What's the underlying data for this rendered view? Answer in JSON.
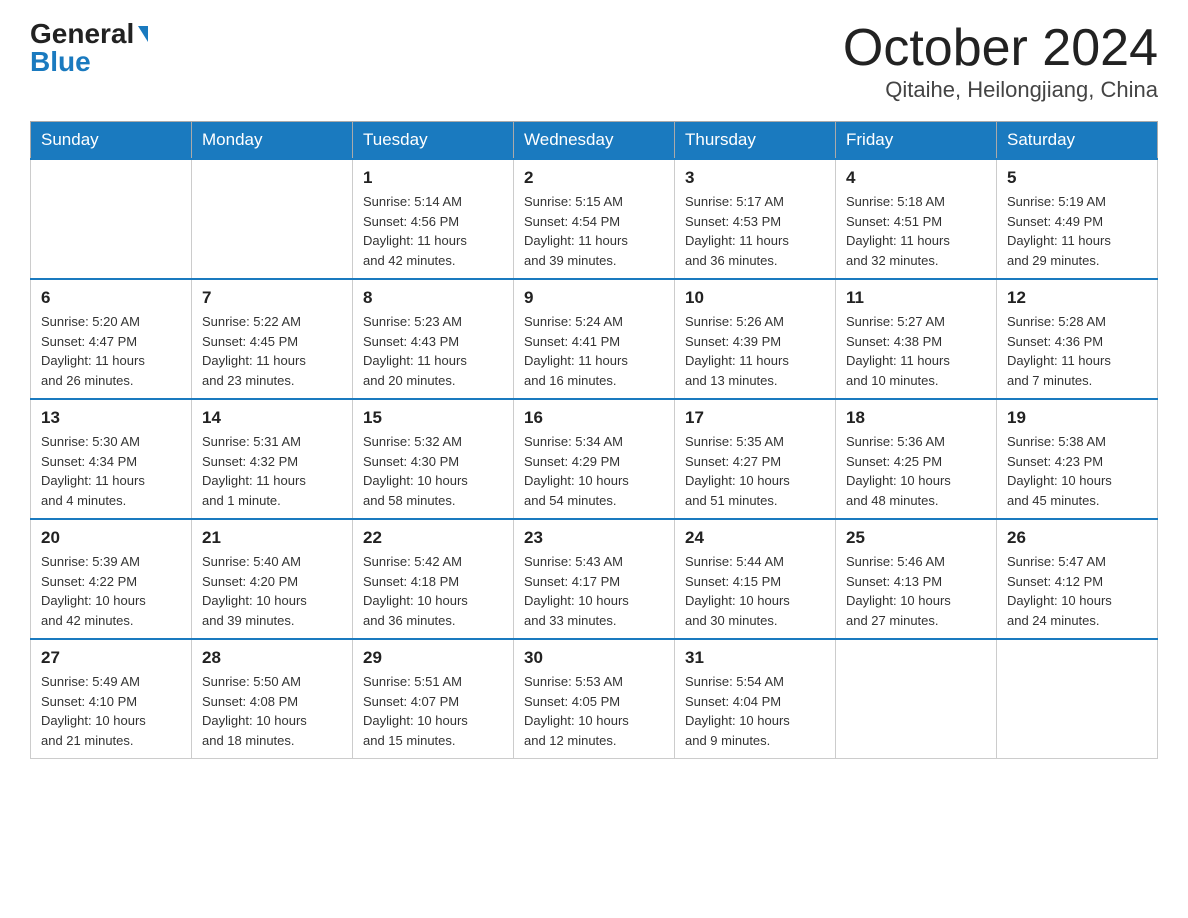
{
  "header": {
    "logo_general": "General",
    "logo_blue": "Blue",
    "month": "October 2024",
    "location": "Qitaihe, Heilongjiang, China"
  },
  "days_of_week": [
    "Sunday",
    "Monday",
    "Tuesday",
    "Wednesday",
    "Thursday",
    "Friday",
    "Saturday"
  ],
  "weeks": [
    [
      {
        "day": "",
        "info": ""
      },
      {
        "day": "",
        "info": ""
      },
      {
        "day": "1",
        "info": "Sunrise: 5:14 AM\nSunset: 4:56 PM\nDaylight: 11 hours\nand 42 minutes."
      },
      {
        "day": "2",
        "info": "Sunrise: 5:15 AM\nSunset: 4:54 PM\nDaylight: 11 hours\nand 39 minutes."
      },
      {
        "day": "3",
        "info": "Sunrise: 5:17 AM\nSunset: 4:53 PM\nDaylight: 11 hours\nand 36 minutes."
      },
      {
        "day": "4",
        "info": "Sunrise: 5:18 AM\nSunset: 4:51 PM\nDaylight: 11 hours\nand 32 minutes."
      },
      {
        "day": "5",
        "info": "Sunrise: 5:19 AM\nSunset: 4:49 PM\nDaylight: 11 hours\nand 29 minutes."
      }
    ],
    [
      {
        "day": "6",
        "info": "Sunrise: 5:20 AM\nSunset: 4:47 PM\nDaylight: 11 hours\nand 26 minutes."
      },
      {
        "day": "7",
        "info": "Sunrise: 5:22 AM\nSunset: 4:45 PM\nDaylight: 11 hours\nand 23 minutes."
      },
      {
        "day": "8",
        "info": "Sunrise: 5:23 AM\nSunset: 4:43 PM\nDaylight: 11 hours\nand 20 minutes."
      },
      {
        "day": "9",
        "info": "Sunrise: 5:24 AM\nSunset: 4:41 PM\nDaylight: 11 hours\nand 16 minutes."
      },
      {
        "day": "10",
        "info": "Sunrise: 5:26 AM\nSunset: 4:39 PM\nDaylight: 11 hours\nand 13 minutes."
      },
      {
        "day": "11",
        "info": "Sunrise: 5:27 AM\nSunset: 4:38 PM\nDaylight: 11 hours\nand 10 minutes."
      },
      {
        "day": "12",
        "info": "Sunrise: 5:28 AM\nSunset: 4:36 PM\nDaylight: 11 hours\nand 7 minutes."
      }
    ],
    [
      {
        "day": "13",
        "info": "Sunrise: 5:30 AM\nSunset: 4:34 PM\nDaylight: 11 hours\nand 4 minutes."
      },
      {
        "day": "14",
        "info": "Sunrise: 5:31 AM\nSunset: 4:32 PM\nDaylight: 11 hours\nand 1 minute."
      },
      {
        "day": "15",
        "info": "Sunrise: 5:32 AM\nSunset: 4:30 PM\nDaylight: 10 hours\nand 58 minutes."
      },
      {
        "day": "16",
        "info": "Sunrise: 5:34 AM\nSunset: 4:29 PM\nDaylight: 10 hours\nand 54 minutes."
      },
      {
        "day": "17",
        "info": "Sunrise: 5:35 AM\nSunset: 4:27 PM\nDaylight: 10 hours\nand 51 minutes."
      },
      {
        "day": "18",
        "info": "Sunrise: 5:36 AM\nSunset: 4:25 PM\nDaylight: 10 hours\nand 48 minutes."
      },
      {
        "day": "19",
        "info": "Sunrise: 5:38 AM\nSunset: 4:23 PM\nDaylight: 10 hours\nand 45 minutes."
      }
    ],
    [
      {
        "day": "20",
        "info": "Sunrise: 5:39 AM\nSunset: 4:22 PM\nDaylight: 10 hours\nand 42 minutes."
      },
      {
        "day": "21",
        "info": "Sunrise: 5:40 AM\nSunset: 4:20 PM\nDaylight: 10 hours\nand 39 minutes."
      },
      {
        "day": "22",
        "info": "Sunrise: 5:42 AM\nSunset: 4:18 PM\nDaylight: 10 hours\nand 36 minutes."
      },
      {
        "day": "23",
        "info": "Sunrise: 5:43 AM\nSunset: 4:17 PM\nDaylight: 10 hours\nand 33 minutes."
      },
      {
        "day": "24",
        "info": "Sunrise: 5:44 AM\nSunset: 4:15 PM\nDaylight: 10 hours\nand 30 minutes."
      },
      {
        "day": "25",
        "info": "Sunrise: 5:46 AM\nSunset: 4:13 PM\nDaylight: 10 hours\nand 27 minutes."
      },
      {
        "day": "26",
        "info": "Sunrise: 5:47 AM\nSunset: 4:12 PM\nDaylight: 10 hours\nand 24 minutes."
      }
    ],
    [
      {
        "day": "27",
        "info": "Sunrise: 5:49 AM\nSunset: 4:10 PM\nDaylight: 10 hours\nand 21 minutes."
      },
      {
        "day": "28",
        "info": "Sunrise: 5:50 AM\nSunset: 4:08 PM\nDaylight: 10 hours\nand 18 minutes."
      },
      {
        "day": "29",
        "info": "Sunrise: 5:51 AM\nSunset: 4:07 PM\nDaylight: 10 hours\nand 15 minutes."
      },
      {
        "day": "30",
        "info": "Sunrise: 5:53 AM\nSunset: 4:05 PM\nDaylight: 10 hours\nand 12 minutes."
      },
      {
        "day": "31",
        "info": "Sunrise: 5:54 AM\nSunset: 4:04 PM\nDaylight: 10 hours\nand 9 minutes."
      },
      {
        "day": "",
        "info": ""
      },
      {
        "day": "",
        "info": ""
      }
    ]
  ]
}
